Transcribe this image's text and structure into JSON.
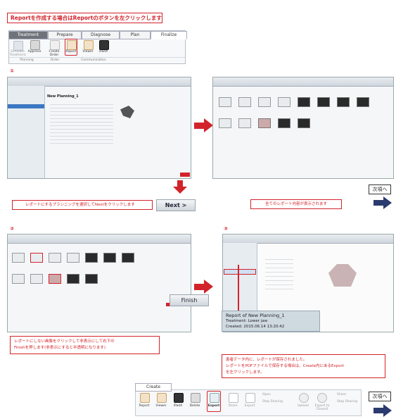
{
  "instruction_top": "Reportを作成する場合はReportのボタンを左クリックします",
  "ribbon_top": {
    "treatment_tab": "Treatment",
    "tabs": [
      "Prepare",
      "Diagnose",
      "Plan",
      "Finalize"
    ],
    "buttons": [
      {
        "label": "Simulate Treatment",
        "icon": "tooth-icon"
      },
      {
        "label": "Approve",
        "icon": "check-icon"
      },
      {
        "label": "Create Order",
        "icon": "cart-icon"
      },
      {
        "label": "Report",
        "icon": "report-icon"
      },
      {
        "label": "Viewer",
        "icon": "viewer-icon"
      },
      {
        "label": "iPadX",
        "icon": "ipad-icon"
      }
    ],
    "groups": [
      "Planning",
      "Order",
      "Communication"
    ]
  },
  "step1": "①",
  "step2": "②",
  "step3": "③",
  "shot1_title": "New Planning_1",
  "next_caption": "レポートにするプランニングを選択してNextをクリックします",
  "next_button": "Next >",
  "all_contents_caption": "全てのレポート内容が表示されます",
  "next_page_1": "次項へ",
  "finish_button": "Finish",
  "hide_caption_line1": "レポートにしない画像をクリックして非表示にして右下の",
  "hide_caption_line2": "Finishを押します(非表示にすると半透明になります)",
  "report_item": {
    "title": "Report of New Planning_1",
    "line1": "Treatment: Lower jaw",
    "line2": "Created: 2015.06.14 13:20:42"
  },
  "saved_caption_line1": "患者データ内に、レポートが保存されました。",
  "saved_caption_line2": "レポートをPDFファイルで保存する場合は、Create内にあるExport",
  "saved_caption_line3": "を左クリックします。",
  "create_ribbon": {
    "tab": "Create",
    "buttons": [
      "Report",
      "Viewer",
      "iPadX",
      "Delete",
      "Export",
      "Share",
      "Export",
      "Open",
      "Stop Sharing",
      "Upload",
      "Export to iTunesX",
      "Share",
      "Stop Sharing"
    ]
  },
  "next_page_2": "次項へ",
  "colors": {
    "accent_red": "#d2232a",
    "caption_border": "#d2232a"
  }
}
